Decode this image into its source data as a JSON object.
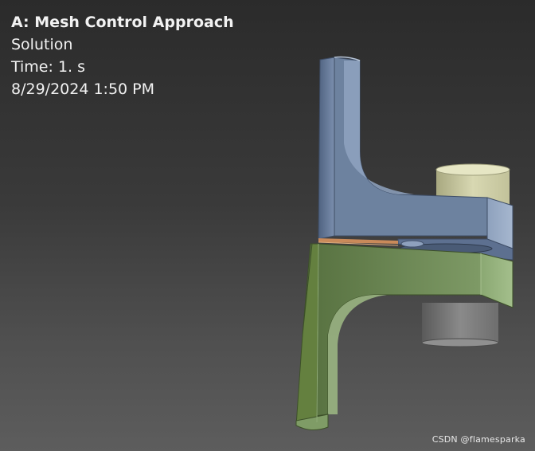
{
  "viewport": {
    "overlay": {
      "title": "A: Mesh Control Approach",
      "type": "Solution",
      "time": "Time: 1. s",
      "date": "8/29/2024 1:50 PM"
    },
    "model": {
      "upper_body_color": "#6c7f9a",
      "lower_body_color": "#6f8a5a",
      "contact_color": "#c98a5a",
      "upper_cylinder_color": "#c9c9a0",
      "lower_cylinder_color": "#7a7a7a"
    },
    "watermark": "CSDN @flamesparka"
  }
}
